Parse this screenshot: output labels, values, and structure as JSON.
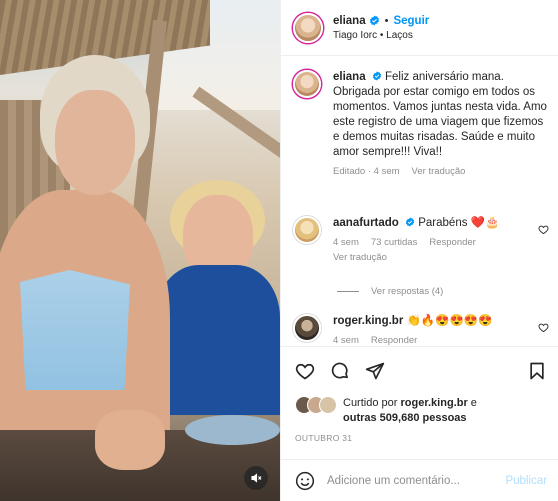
{
  "colors": {
    "accent": "#0095f6",
    "muted": "#8e8e8e",
    "publish_disabled": "#b2dffc"
  },
  "header": {
    "username": "eliana",
    "separator": "•",
    "follow_label": "Seguir",
    "song": "Tiago Iorc • Laços"
  },
  "caption": {
    "username": "eliana",
    "text": "Feliz aniversário mana. Obrigada por estar comigo em todos os momentos. Vamos juntas nesta vida. Amo este registro de uma viagem que fizemos e demos muitas risadas. Saúde e muito amor sempre!!! Viva!!",
    "edited": "Editado · 4 sem",
    "see_translation": "Ver tradução"
  },
  "comments": [
    {
      "username": "aanafurtado",
      "text": "Parabéns ❤️🎂",
      "time": "4 sem",
      "likes": "73 curtidas",
      "reply": "Responder",
      "see_translation": "Ver tradução"
    },
    {
      "username": "roger.king.br",
      "text": "👏🔥😍😍😍😍",
      "time": "4 sem",
      "reply": "Responder"
    }
  ],
  "view_replies": "Ver respostas (4)",
  "likes": {
    "prefix": "Curtido por",
    "user": "roger.king.br",
    "connector": "e",
    "others": "outras 509,680 pessoas"
  },
  "date": "OUTUBRO 31",
  "add_comment": {
    "placeholder": "Adicione um comentário...",
    "publish_label": "Publicar"
  },
  "icons": [
    "verified-icon",
    "heart-icon",
    "comment-icon",
    "share-icon",
    "save-icon",
    "emoji-icon",
    "mute-icon",
    "small-heart-icon"
  ]
}
